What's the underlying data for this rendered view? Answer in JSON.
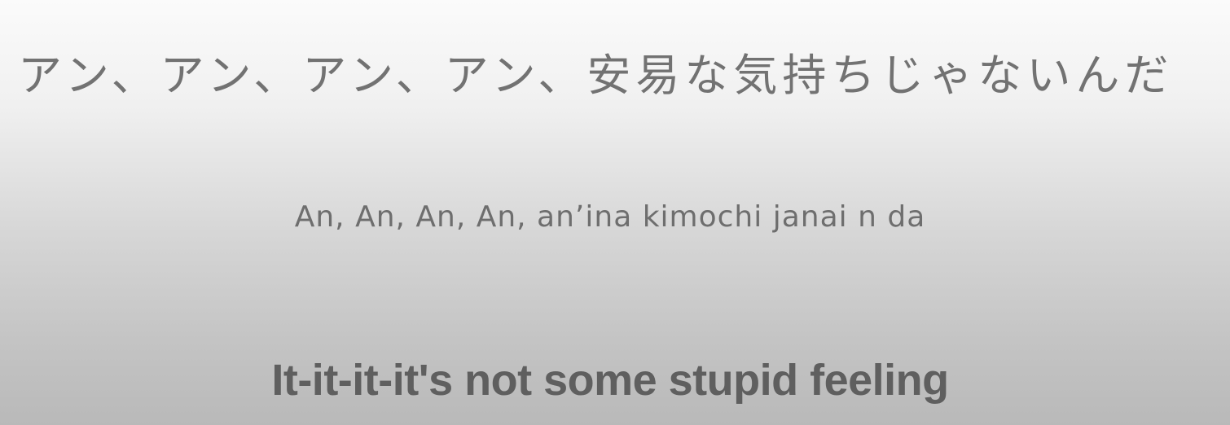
{
  "lyrics": {
    "japanese": "アン、アン、アン、アン、安易な気持ちじゃないんだ",
    "romaji": "An, An, An, An, an’ina kimochi janai n da",
    "english": "It-it-it-it's not some stupid feeling"
  },
  "colors": {
    "text": "#6e6e6e",
    "background_top": "#fbfbfb",
    "background_bottom": "#b9b9b9"
  }
}
